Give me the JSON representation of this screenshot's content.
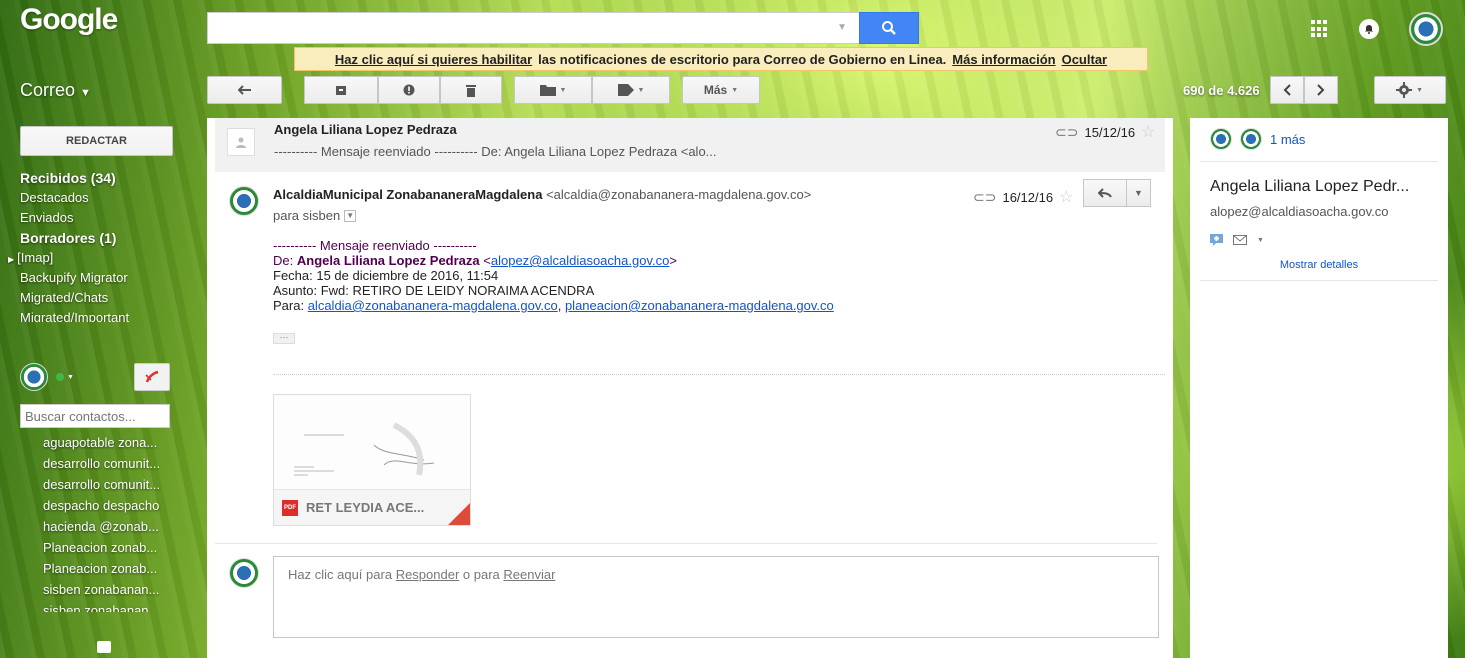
{
  "header": {
    "logo": "Google",
    "search_value": "",
    "notification": {
      "link_enable": "Haz clic aquí si quieres habilitar",
      "text": "las notificaciones de escritorio para Correo de Gobierno en Linea.",
      "link_more": "Más información",
      "link_hide": "Ocultar"
    }
  },
  "app_title": "Correo",
  "toolbar": {
    "more_label": "Más",
    "pager_text": "690 de 4.626"
  },
  "sidebar": {
    "compose_label": "REDACTAR",
    "items": [
      {
        "label": "Recibidos (34)",
        "bold": true
      },
      {
        "label": "Destacados",
        "bold": false
      },
      {
        "label": "Enviados",
        "bold": false
      },
      {
        "label": "Borradores (1)",
        "bold": true
      },
      {
        "label": "[Imap]",
        "bold": false
      },
      {
        "label": "Backupify Migrator",
        "bold": false
      },
      {
        "label": "Migrated/Chats",
        "bold": false
      },
      {
        "label": "Migrated/Important",
        "bold": false
      }
    ],
    "contact_search_placeholder": "Buscar contactos...",
    "contacts": [
      "aguapotable zona...",
      "desarrollo comunit...",
      "desarrollo comunit...",
      "despacho despacho",
      "hacienda @zonab...",
      "Planeacion zonab...",
      "Planeacion zonab...",
      "sisben zonabanan...",
      "sisben zonabanan..."
    ]
  },
  "messages": {
    "collapsed": {
      "sender": "Angela Liliana Lopez Pedraza",
      "snippet": "---------- Mensaje reenviado ---------- De: Angela Liliana Lopez Pedraza <alo...",
      "date": "15/12/16"
    },
    "expanded": {
      "sender": "AlcaldiaMunicipal ZonabananeraMagdalena",
      "sender_email": "<alcaldia@zonabananera-magdalena.gov.co>",
      "to_line": "para sisben",
      "date": "16/12/16",
      "body": {
        "forward_header": "---------- Mensaje reenviado ----------",
        "from_label": "De:",
        "from_name": "Angela Liliana Lopez Pedraza",
        "from_email": "alopez@alcaldiasoacha.gov.co",
        "date_line": "Fecha: 15 de diciembre de 2016, 11:54",
        "subject_line": "Asunto: Fwd: RETIRO DE LEIDY NORAIMA ACENDRA",
        "to_label": "Para:",
        "to_email_1": "alcaldia@zonabananera-magdalena.gov.co",
        "to_email_2": "planeacion@zonabananera-magdalena.gov.co"
      },
      "attachment": {
        "name": "RET LEYDIA ACE...",
        "type_label": "PDF"
      }
    },
    "reply_box": {
      "prefix": "Haz clic aquí para",
      "reply": "Responder",
      "middle": "o para",
      "forward": "Reenviar"
    }
  },
  "right_pane": {
    "more_people": "1 más",
    "name": "Angela Liliana Lopez Pedr...",
    "email": "alopez@alcaldiasoacha.gov.co",
    "details_link": "Mostrar detalles"
  },
  "colors": {
    "accent_blue": "#4285f4",
    "link_blue": "#1155cc",
    "notify_bg": "#f9edbe",
    "pdf_red": "#dd2c2c"
  }
}
